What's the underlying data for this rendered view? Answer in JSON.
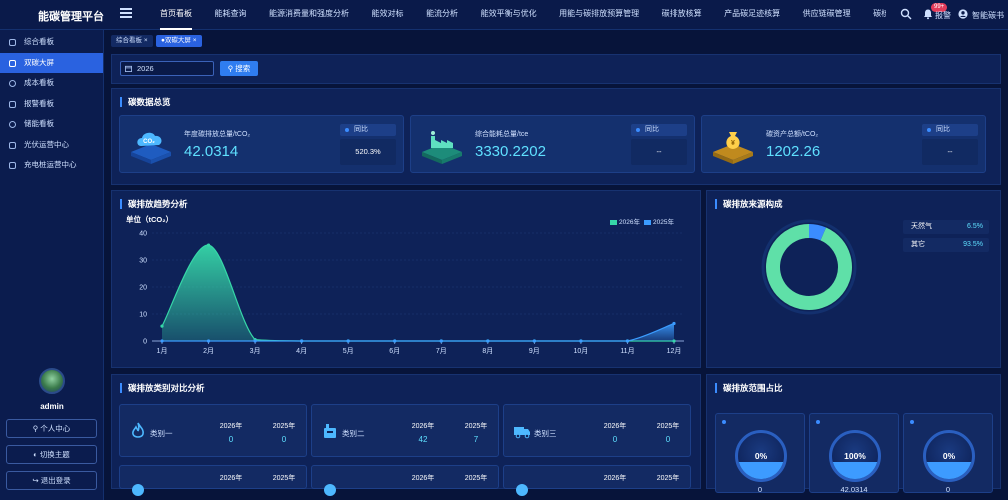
{
  "app": {
    "title": "能碳管理平台"
  },
  "nav": [
    "首页看板",
    "能耗查询",
    "能源消费量和强度分析",
    "能效对标",
    "能流分析",
    "能效平衡与优化",
    "用能与碳排放预算管理",
    "碳排放核算",
    "产品碳足迹核算",
    "供应链碳管理",
    "碳核查支撑",
    "碳资"
  ],
  "topbar": {
    "alarm_badge": "99+",
    "alarm_label": "报警",
    "user_label": "智能碳书"
  },
  "sidebar": {
    "items": [
      "综合看板",
      "双碳大屏",
      "成本看板",
      "报警看板",
      "储能看板",
      "光伏运营中心",
      "充电桩运营中心"
    ],
    "username": "admin",
    "buttons": [
      "个人中心",
      "切换主题",
      "退出登录"
    ]
  },
  "tabs": [
    {
      "label": "综合看板",
      "close": "×"
    },
    {
      "label": "●双碳大屏",
      "close": "×"
    }
  ],
  "filter": {
    "year": "2026",
    "search_label": "搜索"
  },
  "overview": {
    "title": "碳数据总览",
    "yoy_label": "同比",
    "cards": [
      {
        "label": "年度碳排放总量/tCO₂",
        "value": "42.0314",
        "yoy": "520.3%",
        "icon": "co2-cloud-icon"
      },
      {
        "label": "综合能耗总量/tce",
        "value": "3330.2202",
        "yoy": "--",
        "icon": "factory-icon"
      },
      {
        "label": "碳资产总额/tCO₂",
        "value": "1202.26",
        "yoy": "--",
        "icon": "money-bag-icon"
      }
    ]
  },
  "trend": {
    "title": "碳排放趋势分析",
    "unit": "单位（tCO₂）"
  },
  "chart_data": [
    {
      "type": "area",
      "title": "碳排放趋势分析",
      "ylabel": "单位（tCO₂）",
      "categories": [
        "1月",
        "2月",
        "3月",
        "4月",
        "5月",
        "6月",
        "7月",
        "8月",
        "9月",
        "10月",
        "11月",
        "12月"
      ],
      "yticks": [
        "0",
        "10",
        "20",
        "30",
        "40"
      ],
      "ylim": [
        0,
        40
      ],
      "series": [
        {
          "name": "2026年",
          "color": "#36d7a8",
          "values": [
            5.5,
            35.5,
            0.5,
            0,
            0,
            0,
            0,
            0,
            0,
            0,
            0,
            0
          ]
        },
        {
          "name": "2025年",
          "color": "#3b9cff",
          "values": [
            0,
            0,
            0,
            0,
            0,
            0,
            0,
            0,
            0,
            0,
            0,
            6.5
          ]
        }
      ]
    },
    {
      "type": "pie",
      "title": "碳排放来源构成",
      "labels": [
        "天然气",
        "其它"
      ],
      "values": [
        6.5,
        93.5
      ],
      "display": [
        "6.5%",
        "93.5%"
      ],
      "colors": [
        "#3b8cff",
        "#5fe0a8"
      ]
    }
  ],
  "source": {
    "title": "碳排放来源构成"
  },
  "category": {
    "title": "碳排放类别对比分析",
    "year_a": "2026年",
    "year_b": "2025年",
    "cards": [
      {
        "label": "类别一",
        "a": "0",
        "b": "0",
        "icon": "flame-icon"
      },
      {
        "label": "类别二",
        "a": "42",
        "b": "7",
        "icon": "boiler-icon"
      },
      {
        "label": "类别三",
        "a": "0",
        "b": "0",
        "icon": "truck-icon"
      }
    ],
    "row2": [
      {
        "icon": "category-icon"
      },
      {
        "icon": "category-icon"
      },
      {
        "icon": "category-icon"
      }
    ]
  },
  "scope": {
    "title": "碳排放范围占比",
    "cards": [
      {
        "pct_label": "0%",
        "fraction": 0.38,
        "value": "0"
      },
      {
        "pct_label": "100%",
        "fraction": 0.38,
        "value": "42.0314"
      },
      {
        "pct_label": "0%",
        "fraction": 0.38,
        "value": "0"
      }
    ]
  },
  "colors": {
    "accent": "#3b8cff",
    "teal": "#36d7a8",
    "cyan": "#5fe0ff",
    "bg": "#07143a"
  }
}
